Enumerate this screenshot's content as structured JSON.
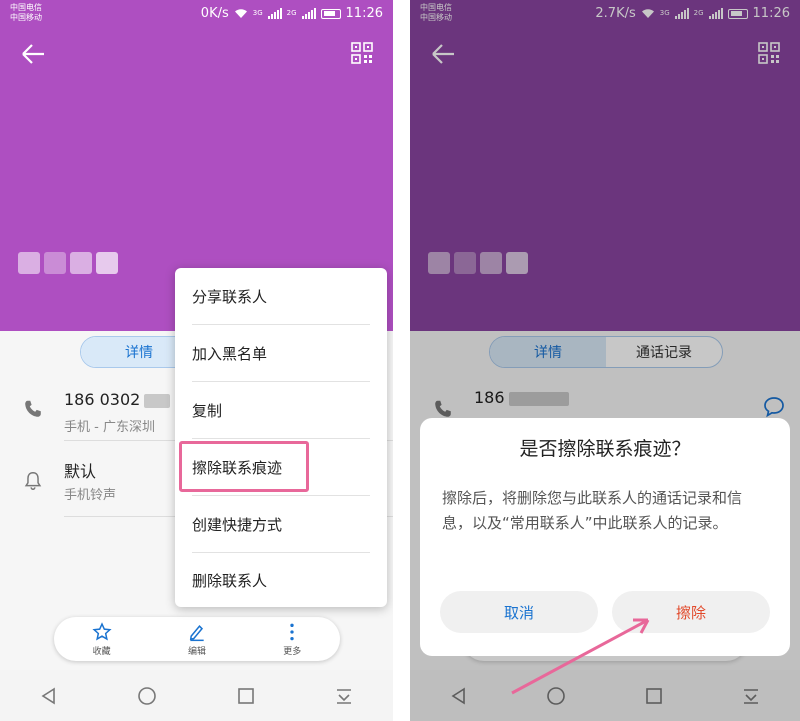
{
  "colors": {
    "header_left": "#ae4fc1",
    "header_right": "#8a44a0",
    "accent": "#1a73d0",
    "danger": "#e24a2c",
    "annotation": "#e8689a"
  },
  "left": {
    "status": {
      "carrier1": "中国电信",
      "carrier2": "中国移动",
      "speed": "0K/s",
      "time": "11:26",
      "net1": "3G",
      "net2": "2G"
    },
    "tabs": {
      "details": "详情"
    },
    "phone_row": {
      "number": "186 0302",
      "sub": "手机 - 广东深圳"
    },
    "ringtone_row": {
      "title": "默认",
      "sub": "手机铃声"
    },
    "menu": {
      "items": [
        {
          "label": "分享联系人"
        },
        {
          "label": "加入黑名单"
        },
        {
          "label": "复制"
        },
        {
          "label": "擦除联系痕迹"
        },
        {
          "label": "创建快捷方式"
        },
        {
          "label": "删除联系人"
        }
      ]
    },
    "actions": {
      "favorite": "收藏",
      "edit": "编辑",
      "more": "更多"
    }
  },
  "right": {
    "status": {
      "carrier1": "中国电信",
      "carrier2": "中国移动",
      "speed": "2.7K/s",
      "time": "11:26",
      "net1": "3G",
      "net2": "2G"
    },
    "tabs": {
      "details": "详情",
      "call_log": "通话记录"
    },
    "phone_row": {
      "number": "186"
    },
    "dialog": {
      "title": "是否擦除联系痕迹？",
      "body": "擦除后，将删除您与此联系人的通话记录和信息，以及“常用联系人”中此联系人的记录。",
      "cancel": "取消",
      "confirm": "擦除"
    }
  }
}
